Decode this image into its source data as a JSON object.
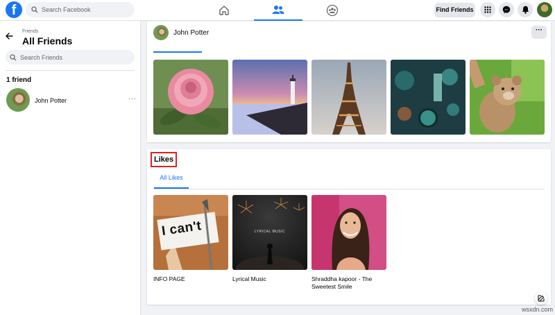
{
  "topbar": {
    "logo": "f",
    "search_placeholder": "Search Facebook",
    "nav": [
      "home-icon",
      "friends-icon",
      "groups-icon"
    ],
    "find_friends_label": "Find Friends",
    "icons": [
      "menu-grid-icon",
      "messenger-icon",
      "bell-icon"
    ]
  },
  "sidebar": {
    "breadcrumb": "Friends",
    "title": "All Friends",
    "search_placeholder": "Search Friends",
    "friend_count": "1 friend",
    "friends": [
      {
        "name": "John Potter",
        "more": "···"
      }
    ]
  },
  "profile_header": {
    "name": "John Potter",
    "more": "···"
  },
  "photos": [
    "pink-rose",
    "lighthouse-sunset",
    "eiffel-tower",
    "teal-bokeh",
    "teddy-bear"
  ],
  "likes": {
    "title": "Likes",
    "tab_label": "All Likes",
    "items": [
      {
        "label": "INFO PAGE",
        "image_text": "I can't"
      },
      {
        "label": "Lyrical Music",
        "image_text": "LYRICAL MUSIC"
      },
      {
        "label": "Shraddha kapoor - The Sweetest Smile",
        "image_text": ""
      }
    ]
  },
  "watermark": "wsxdn.com",
  "colors": {
    "accent": "#1877f2",
    "highlight": "#e02020"
  }
}
